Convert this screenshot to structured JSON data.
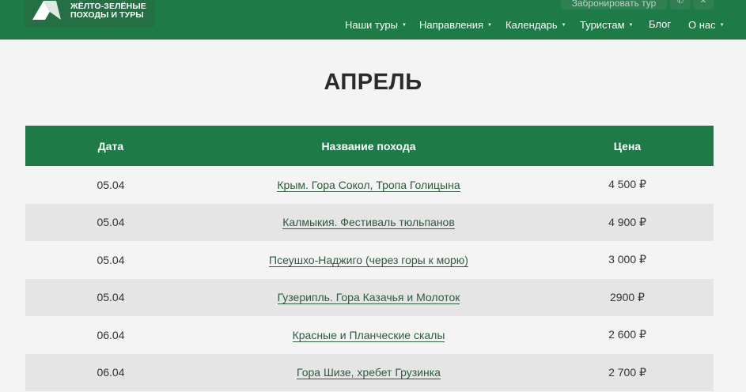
{
  "header": {
    "logo_line1": "ЖЁЛТО-ЗЕЛЁНЫЕ",
    "logo_line2": "ПОХОДЫ И ТУРЫ",
    "book_button": "Забронировать тур",
    "social": [
      "whatsapp-icon",
      "vk-icon"
    ],
    "nav": [
      {
        "label": "Наши туры",
        "dropdown": true
      },
      {
        "label": "Направления",
        "dropdown": true
      },
      {
        "label": "Календарь",
        "dropdown": true
      },
      {
        "label": "Туристам",
        "dropdown": true
      },
      {
        "label": "Блог",
        "dropdown": false
      },
      {
        "label": "О нас",
        "dropdown": true
      }
    ],
    "colors": {
      "brand": "#1e7a47"
    }
  },
  "page_title": "АПРЕЛЬ",
  "table": {
    "headers": [
      "Дата",
      "Название похода",
      "Цена"
    ],
    "rows": [
      {
        "date": "05.04",
        "name": "Крым. Гора Сокол, Тропа Голицына",
        "price": "4 500 ₽"
      },
      {
        "date": "05.04",
        "name": "Калмыкия. Фестиваль тюльпанов",
        "price": "4 900 ₽"
      },
      {
        "date": "05.04",
        "name": "Псеушхо-Наджиго (через горы к морю)",
        "price": "3 000 ₽"
      },
      {
        "date": "05.04",
        "name": "Гузерипль. Гора Казачья и Молоток",
        "price": "2900 ₽"
      },
      {
        "date": "06.04",
        "name": "Красные и Планческие скалы",
        "price": "2 600 ₽"
      },
      {
        "date": "06.04",
        "name": "Гора Шизе, хребет Грузинка",
        "price": "2 700 ₽"
      }
    ]
  }
}
